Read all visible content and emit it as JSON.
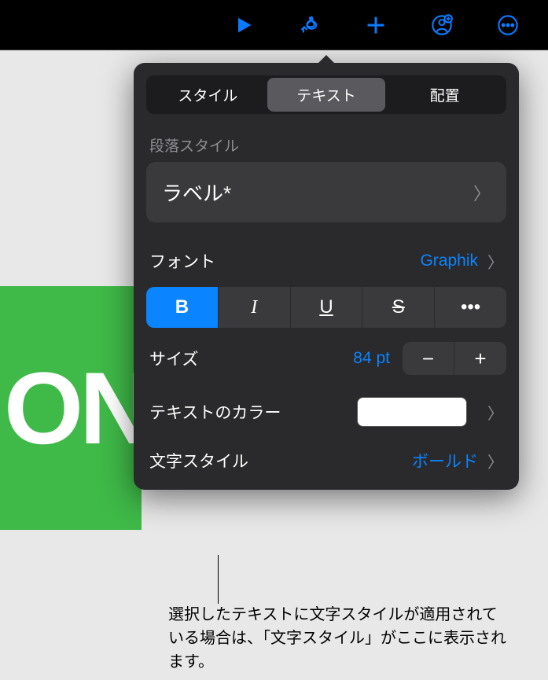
{
  "toolbar": {
    "play": "play-icon",
    "format": "paintbrush-icon",
    "add": "plus-icon",
    "collab": "person-plus-icon",
    "more": "ellipsis-icon"
  },
  "popover": {
    "tabs": {
      "style": "スタイル",
      "text": "テキスト",
      "arrange": "配置"
    },
    "para_section": "段落スタイル",
    "para_value": "ラベル*",
    "font_label": "フォント",
    "font_value": "Graphik",
    "buttons": {
      "bold": "B",
      "italic": "I",
      "underline": "U",
      "strike": "S",
      "more": "•••"
    },
    "size_label": "サイズ",
    "size_value": "84 pt",
    "color_label": "テキストのカラー",
    "color_value": "#ffffff",
    "charstyle_label": "文字スタイル",
    "charstyle_value": "ボールド"
  },
  "slide_text": "ON",
  "callout": "選択したテキストに文字スタイルが適用されている場合は、「文字スタイル」がここに表示されます。"
}
